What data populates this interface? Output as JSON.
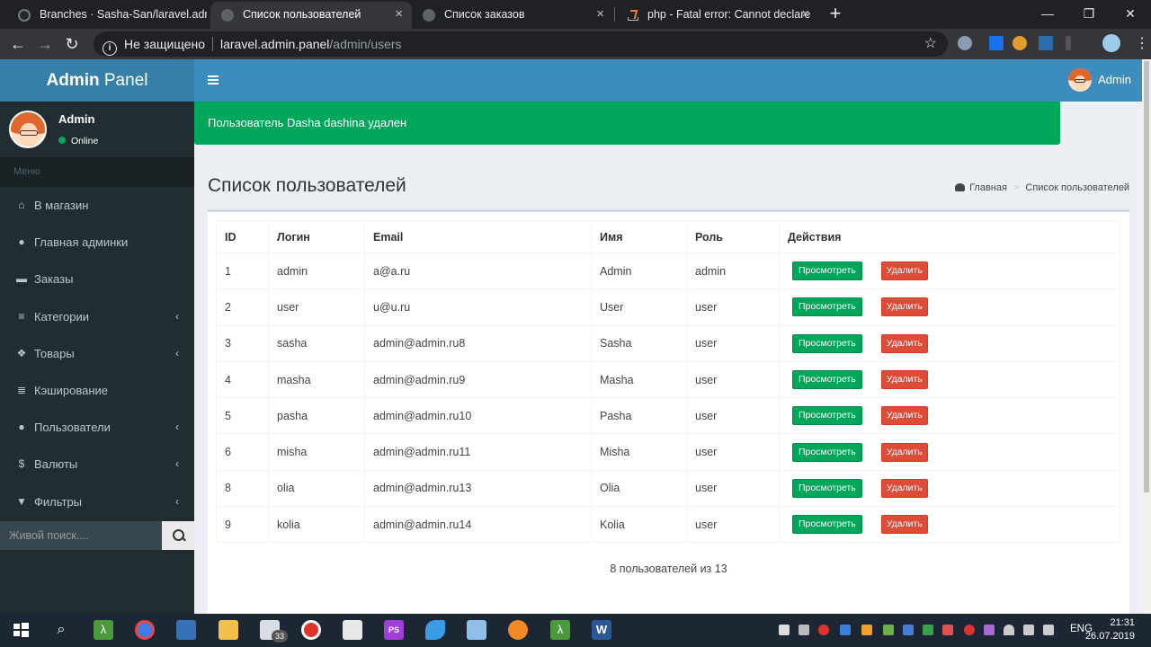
{
  "browser": {
    "tabs": [
      {
        "title": "Branches · Sasha-San/laravel.adm"
      },
      {
        "title": "Список пользователей"
      },
      {
        "title": "Список заказов"
      },
      {
        "title": "php - Fatal error: Cannot declare"
      }
    ],
    "security_label": "Не защищено",
    "url_host": "laravel.admin.panel",
    "url_path": "/admin/users"
  },
  "sidebar": {
    "logo_bold": "Admin",
    "logo_light": " Panel",
    "user_name": "Admin",
    "user_status": "Online",
    "menu_header": "Меню",
    "items": [
      {
        "label": "В магазин",
        "icon": "home-icon",
        "glyph": "⌂"
      },
      {
        "label": "Главная админки",
        "icon": "user-icon",
        "glyph": "●"
      },
      {
        "label": "Заказы",
        "icon": "cart-icon",
        "glyph": "▬"
      },
      {
        "label": "Категории",
        "icon": "bars-icon",
        "glyph": "≡"
      },
      {
        "label": "Товары",
        "icon": "cubes-icon",
        "glyph": "❖"
      },
      {
        "label": "Кэширование",
        "icon": "database-icon",
        "glyph": "≣"
      },
      {
        "label": "Пользователи",
        "icon": "users-icon",
        "glyph": "●"
      },
      {
        "label": "Валюты",
        "icon": "dollar-icon",
        "glyph": "$"
      },
      {
        "label": "Фильтры",
        "icon": "filter-icon",
        "glyph": "▼"
      }
    ],
    "search_placeholder": "Живой поиск...."
  },
  "header": {
    "user_name": "Admin"
  },
  "alert": {
    "text": "Пользователь Dasha dashina удален"
  },
  "page": {
    "title": "Список пользователей",
    "breadcrumb_home": "Главная",
    "breadcrumb_current": "Список пользователей"
  },
  "table": {
    "headers": [
      "ID",
      "Логин",
      "Email",
      "Имя",
      "Роль",
      "Действия"
    ],
    "view_label": "Просмотреть",
    "delete_label": "Удалить",
    "rows": [
      {
        "id": "1",
        "login": "admin",
        "email": "a@a.ru",
        "name": "Admin",
        "role": "admin"
      },
      {
        "id": "2",
        "login": "user",
        "email": "u@u.ru",
        "name": "User",
        "role": "user"
      },
      {
        "id": "3",
        "login": "sasha",
        "email": "admin@admin.ru8",
        "name": "Sasha",
        "role": "user"
      },
      {
        "id": "4",
        "login": "masha",
        "email": "admin@admin.ru9",
        "name": "Masha",
        "role": "user"
      },
      {
        "id": "5",
        "login": "pasha",
        "email": "admin@admin.ru10",
        "name": "Pasha",
        "role": "user"
      },
      {
        "id": "6",
        "login": "misha",
        "email": "admin@admin.ru11",
        "name": "Misha",
        "role": "user"
      },
      {
        "id": "8",
        "login": "olia",
        "email": "admin@admin.ru13",
        "name": "Olia",
        "role": "user"
      },
      {
        "id": "9",
        "login": "kolia",
        "email": "admin@admin.ru14",
        "name": "Kolia",
        "role": "user"
      }
    ],
    "summary": "8 пользователей из 13"
  },
  "taskbar": {
    "time": "21:31",
    "date": "26.07.2019",
    "lang": "ENG",
    "mail_badge": "33"
  },
  "colors": {
    "sidebar": "#222d32",
    "header": "#3c8dbc",
    "success": "#00a65a",
    "danger": "#dd4b39"
  }
}
